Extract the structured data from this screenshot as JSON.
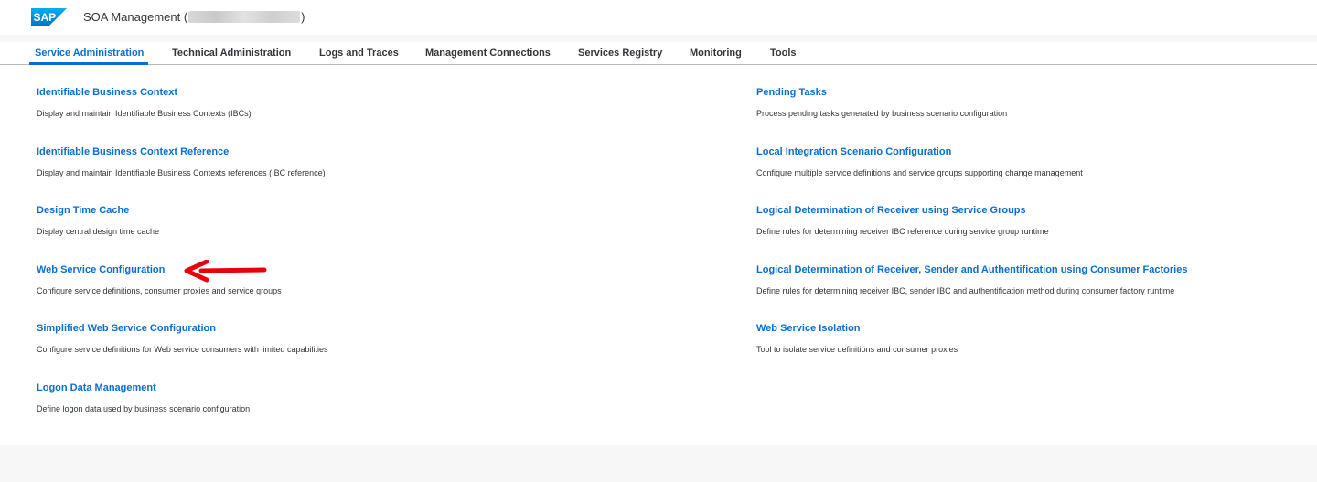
{
  "shell": {
    "logo_text": "SAP",
    "title_prefix": "SOA Management (",
    "title_suffix": ")"
  },
  "tabs": [
    {
      "label": "Service Administration",
      "selected": true
    },
    {
      "label": "Technical Administration",
      "selected": false
    },
    {
      "label": "Logs and Traces",
      "selected": false
    },
    {
      "label": "Management Connections",
      "selected": false
    },
    {
      "label": "Services Registry",
      "selected": false
    },
    {
      "label": "Monitoring",
      "selected": false
    },
    {
      "label": "Tools",
      "selected": false
    }
  ],
  "left_column": [
    {
      "title": "Identifiable Business Context",
      "description": "Display and maintain Identifiable Business Contexts (IBCs)"
    },
    {
      "title": "Identifiable Business Context Reference",
      "description": "Display and maintain Identifiable Business Contexts references (IBC reference)"
    },
    {
      "title": "Design Time Cache",
      "description": "Display central design time cache"
    },
    {
      "title": "Web Service Configuration",
      "description": "Configure service definitions, consumer proxies and service groups"
    },
    {
      "title": "Simplified Web Service Configuration",
      "description": "Configure service definitions for Web service consumers with limited capabilities"
    },
    {
      "title": "Logon Data Management",
      "description": "Define logon data used by business scenario configuration"
    }
  ],
  "right_column": [
    {
      "title": "Pending Tasks",
      "description": "Process pending tasks generated by business scenario configuration"
    },
    {
      "title": "Local Integration Scenario Configuration",
      "description": "Configure multiple service definitions and service groups supporting change management"
    },
    {
      "title": "Logical Determination of Receiver using Service Groups",
      "description": "Define rules for determining receiver IBC reference during service group runtime"
    },
    {
      "title": "Logical Determination of Receiver, Sender and Authentification using Consumer Factories",
      "description": "Define rules for determining receiver IBC, sender IBC and authentification method during consumer factory runtime"
    },
    {
      "title": "Web Service Isolation",
      "description": "Tool to isolate service definitions and consumer proxies"
    }
  ],
  "colors": {
    "accent": "#0a6ed1",
    "text": "#32363a",
    "annotation": "#e8000b",
    "shell_background": "#ffffff",
    "page_background": "#f7f7f7"
  },
  "icons": {
    "logo": "sap-logo",
    "annotation": "red-arrow-left-icon"
  }
}
